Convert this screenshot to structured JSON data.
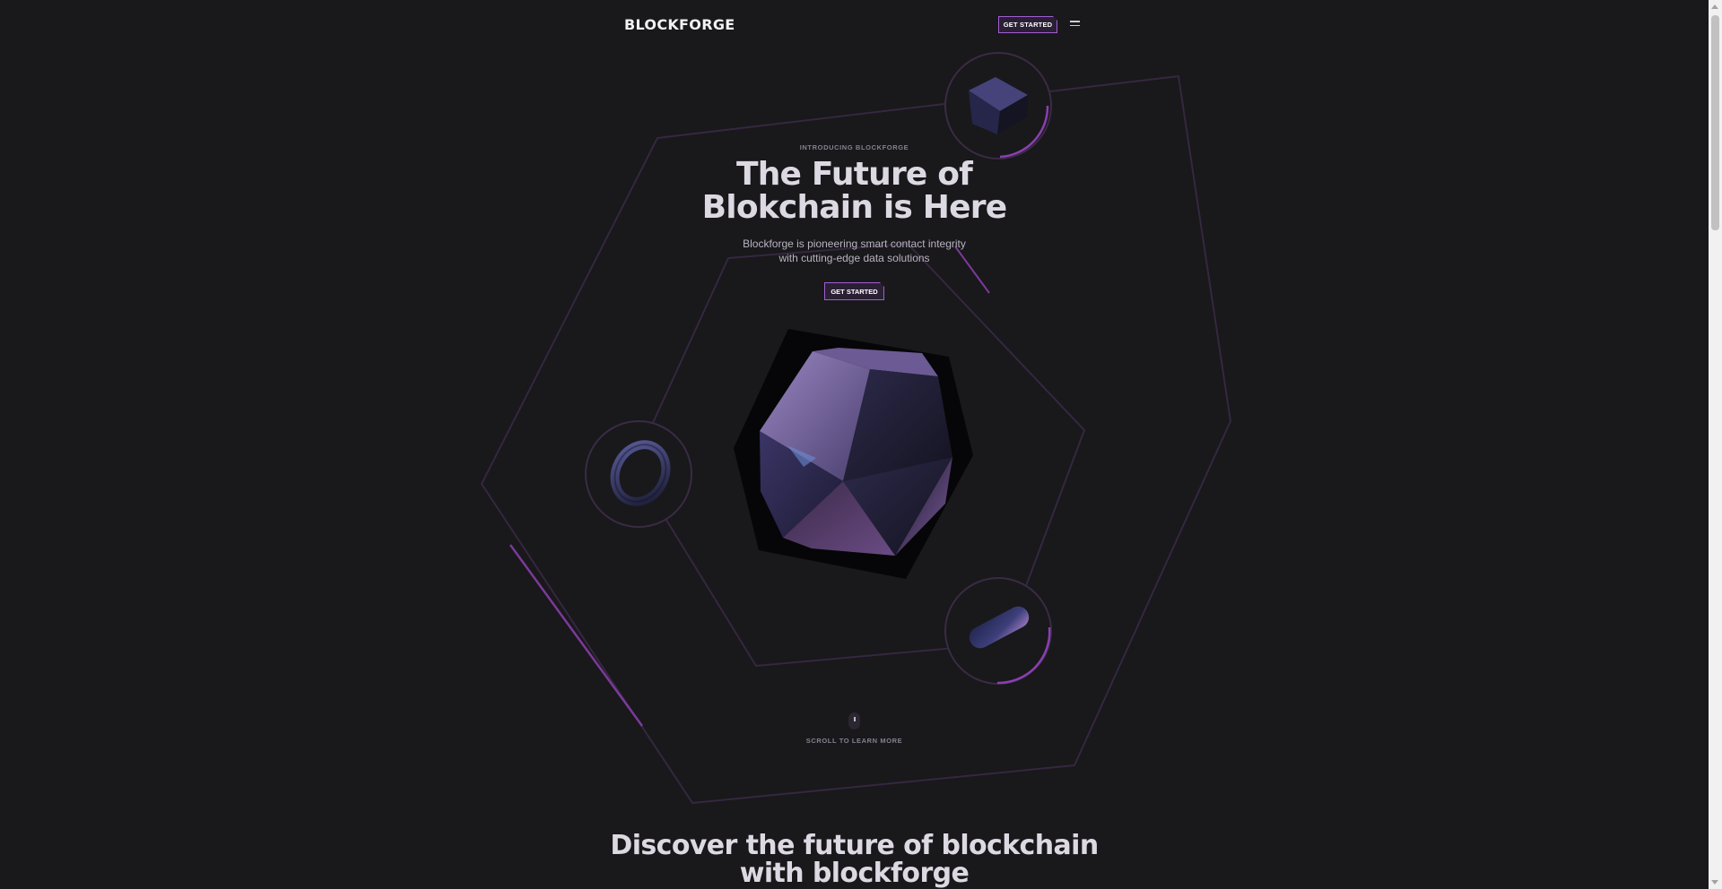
{
  "nav": {
    "logo": "BLOCKFORGE",
    "cta_label": "GET STARTED",
    "menu_icon": "hamburger-menu-icon"
  },
  "hero": {
    "eyebrow": "INTRODUCING BLOCKFORGE",
    "title_line1": "The Future of",
    "title_line2": "Blokchain is Here",
    "subtitle_line1": "Blockforge is pioneering smart contact integrity",
    "subtitle_line2": "with cutting-edge data solutions",
    "cta_label": "GET STARTED"
  },
  "scroll": {
    "label": "SCROLL TO LEARN MORE",
    "icon": "mouse-icon"
  },
  "section": {
    "title_line1": "Discover the future of blockchain",
    "title_line2": "with blockforge"
  },
  "colors": {
    "background": "#19181b",
    "accent": "#a05fd2",
    "hex_outline": "#3a2a44",
    "text": "#dcd9e2"
  },
  "objects": [
    "icosahedron-3d",
    "cube-3d",
    "torus-3d",
    "capsule-3d"
  ]
}
